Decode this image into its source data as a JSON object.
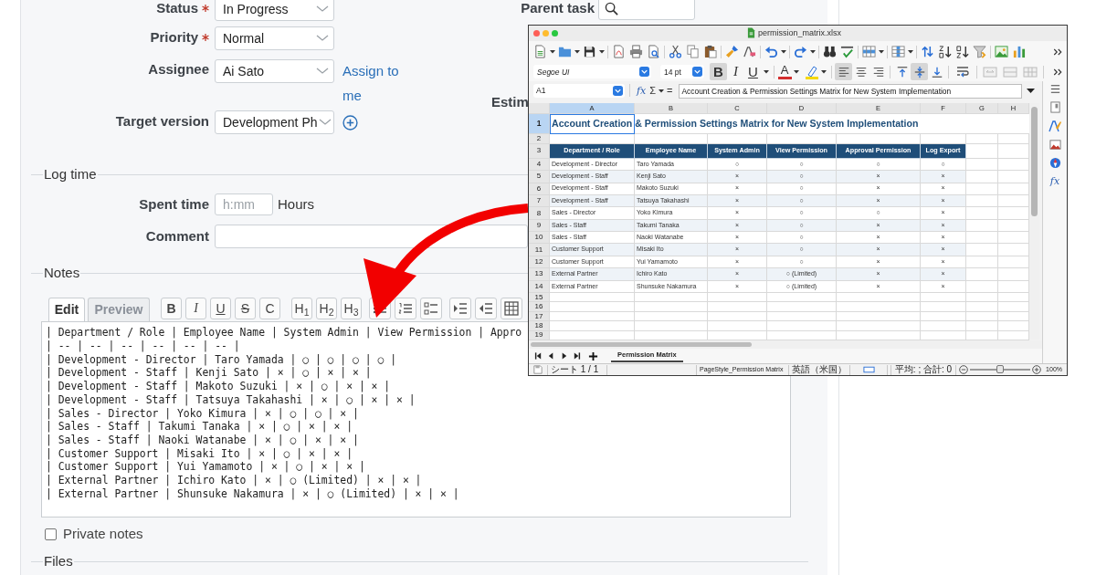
{
  "form": {
    "fields": [
      {
        "label": "Status",
        "required": true,
        "value": "In Progress"
      },
      {
        "label": "Priority",
        "required": true,
        "value": "Normal"
      },
      {
        "label": "Assignee",
        "required": false,
        "value": "Ai Sato",
        "link": "Assign to me"
      },
      {
        "label": "Target version",
        "required": false,
        "value": "Development Ph",
        "add_button": true
      }
    ],
    "parent_task": {
      "label": "Parent task"
    },
    "estimated_label": "Estim"
  },
  "log_time": {
    "legend": "Log time",
    "spent_time": {
      "label": "Spent time",
      "placeholder": "h:mm",
      "unit": "Hours"
    },
    "comment": {
      "label": "Comment"
    }
  },
  "notes": {
    "legend": "Notes",
    "tabs": [
      {
        "label": "Edit",
        "selected": true
      },
      {
        "label": "Preview",
        "selected": false
      }
    ],
    "toolbar": [
      {
        "label": "B",
        "kind": "bold"
      },
      {
        "label": "I",
        "kind": "italic"
      },
      {
        "label": "U",
        "kind": "underline"
      },
      {
        "label": "S",
        "kind": "strike"
      },
      {
        "label": "C",
        "kind": "code"
      },
      {
        "label": "H$_{1}$",
        "kind": "heading"
      },
      {
        "label": "H$_{2}$",
        "kind": "heading"
      },
      {
        "label": "H$_{3}$",
        "kind": "heading"
      }
    ],
    "lines": [
      "| Department / Role | Employee Name | System Admin | View Permission | Appro",
      "| -- | -- | -- | -- | -- | -- |",
      "| Development - Director | Taro Yamada | ○ | ○ | ○ | ○ |",
      "| Development - Staff | Kenji Sato | × | ○ | × | × |",
      "| Development - Staff | Makoto Suzuki | × | ○ | × | × |",
      "| Development - Staff | Tatsuya Takahashi | × | ○ | × | × |",
      "| Sales - Director | Yoko Kimura | × | ○ | ○ | × |",
      "| Sales - Staff | Takumi Tanaka | × | ○ | × | × |",
      "| Sales - Staff | Naoki Watanabe | × | ○ | × | × |",
      "| Customer Support | Misaki Ito | × | ○ | × | × |",
      "| Customer Support | Yui Yamamoto | × | ○ | × | × |",
      "| External Partner | Ichiro Kato | × | ○ (Limited) | × | × |",
      "| External Partner | Shunsuke Nakamura | × | ○ (Limited) | × | × |"
    ]
  },
  "private_notes": {
    "label": "Private notes",
    "checked": false
  },
  "files": {
    "legend": "Files"
  },
  "spreadsheet": {
    "title": "permission_matrix.xlsx",
    "font_name": "Segoe UI",
    "font_size": "14 pt",
    "format_buttons": [
      {
        "label": "B",
        "kind": "bold",
        "selected": true
      },
      {
        "label": "I",
        "kind": "italic",
        "selected": false
      },
      {
        "label": "U",
        "kind": "underline",
        "selected": false
      }
    ],
    "font_color_label": "A",
    "horizontal_alignment": [
      {
        "kind": "left",
        "selected": true
      },
      {
        "kind": "center",
        "selected": false
      },
      {
        "kind": "right",
        "selected": false
      }
    ],
    "vertical_alignment": [
      {
        "kind": "top",
        "selected": false
      },
      {
        "kind": "middle",
        "selected": true
      },
      {
        "kind": "bottom",
        "selected": false
      }
    ],
    "cell_reference": "A1",
    "formula_symbols": [
      "fx",
      "Σ",
      "="
    ],
    "formula": "Account Creation & Permission Settings Matrix for New System Implementation",
    "sidebar_function_label": "fx",
    "columns": [
      {
        "label": "A",
        "selected": true
      },
      {
        "label": "B",
        "selected": false
      },
      {
        "label": "C",
        "selected": false
      },
      {
        "label": "D",
        "selected": false
      },
      {
        "label": "E",
        "selected": false
      },
      {
        "label": "F",
        "selected": false
      },
      {
        "label": "G",
        "selected": false
      },
      {
        "label": "H",
        "selected": false
      }
    ],
    "rows": [
      {
        "number": "1",
        "selected": true,
        "kind": "title",
        "cells": [
          "Account Creation & Permission Settings Matrix for New System Implementation"
        ]
      },
      {
        "number": "2",
        "selected": false,
        "kind": "empty"
      },
      {
        "number": "3",
        "selected": false,
        "kind": "header",
        "cells": [
          "Department / Role",
          "Employee Name",
          "System Admin",
          "View Permission",
          "Approval Permission",
          "Log Export"
        ]
      },
      {
        "number": "4",
        "selected": false,
        "kind": "data",
        "cells": [
          "Development - Director",
          "Taro Yamada",
          "○",
          "○",
          "○",
          "○"
        ]
      },
      {
        "number": "5",
        "selected": false,
        "kind": "data",
        "cells": [
          "Development - Staff",
          "Kenji Sato",
          "×",
          "○",
          "×",
          "×"
        ]
      },
      {
        "number": "6",
        "selected": false,
        "kind": "data",
        "cells": [
          "Development - Staff",
          "Makoto Suzuki",
          "×",
          "○",
          "×",
          "×"
        ]
      },
      {
        "number": "7",
        "selected": false,
        "kind": "data",
        "cells": [
          "Development - Staff",
          "Tatsuya Takahashi",
          "×",
          "○",
          "×",
          "×"
        ]
      },
      {
        "number": "8",
        "selected": false,
        "kind": "data",
        "cells": [
          "Sales - Director",
          "Yoko Kimura",
          "×",
          "○",
          "○",
          "×"
        ]
      },
      {
        "number": "9",
        "selected": false,
        "kind": "data",
        "cells": [
          "Sales - Staff",
          "Takumi Tanaka",
          "×",
          "○",
          "×",
          "×"
        ]
      },
      {
        "number": "10",
        "selected": false,
        "kind": "data",
        "cells": [
          "Sales - Staff",
          "Naoki Watanabe",
          "×",
          "○",
          "×",
          "×"
        ]
      },
      {
        "number": "11",
        "selected": false,
        "kind": "data",
        "cells": [
          "Customer Support",
          "Misaki Ito",
          "×",
          "○",
          "×",
          "×"
        ]
      },
      {
        "number": "12",
        "selected": false,
        "kind": "data",
        "cells": [
          "Customer Support",
          "Yui Yamamoto",
          "×",
          "○",
          "×",
          "×"
        ]
      },
      {
        "number": "13",
        "selected": false,
        "kind": "data",
        "cells": [
          "External Partner",
          "Ichiro Kato",
          "×",
          "○ (Limited)",
          "×",
          "×"
        ]
      },
      {
        "number": "14",
        "selected": false,
        "kind": "data",
        "cells": [
          "External Partner",
          "Shunsuke Nakamura",
          "×",
          "○ (Limited)",
          "×",
          "×"
        ]
      },
      {
        "number": "15",
        "selected": false,
        "kind": "empty"
      },
      {
        "number": "16",
        "selected": false,
        "kind": "empty"
      },
      {
        "number": "17",
        "selected": false,
        "kind": "empty"
      },
      {
        "number": "18",
        "selected": false,
        "kind": "empty"
      },
      {
        "number": "19",
        "selected": false,
        "kind": "empty"
      }
    ],
    "sheet_tabs": [
      {
        "label": "Permission Matrix",
        "selected": true
      }
    ],
    "status_bar": {
      "sheet": "シート 1 / 1",
      "page_style": "PageStyle_Permission Matrix",
      "language": "英語（米国）",
      "summary": "平均: ; 合計: 0",
      "zoom": "100%",
      "zoom_slider": {
        "level": 0.5
      }
    }
  }
}
